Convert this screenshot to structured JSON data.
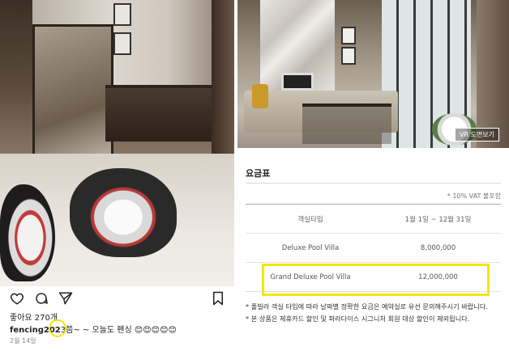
{
  "instagram": {
    "likes": "좋아요 270개",
    "caption_user": "fencing202",
    "caption_mark": "3쯤~",
    "caption_text": "~ 오늘도 펜싱 😊😊😊😊😊",
    "date": "2월 14일",
    "icons": [
      "heart-icon",
      "comment-icon",
      "send-icon",
      "bookmark-icon"
    ]
  },
  "hotel": {
    "vr_button": "VR 도면보기",
    "rate_title": "요금표",
    "vat_note": "* 10% VAT 불포함",
    "table": {
      "headers": [
        "객실타입",
        "1월 1일 ~ 12월 31일"
      ],
      "rows": [
        [
          "Deluxe Pool Villa",
          "8,000,000"
        ],
        [
          "Grand Deluxe Pool Villa",
          "12,000,000"
        ]
      ]
    },
    "footnotes": [
      "* 풀빌라 객실 타입에 따라 날짜별 정확한 요금은 예약실로 유선 문의해주시기 바랍니다.",
      "* 본 상품은 제휴카드 할인 및 파라다이스 시그니처 회원 대상 할인이 제외됩니다."
    ]
  },
  "colors": {
    "highlight": "#f3e60e"
  }
}
